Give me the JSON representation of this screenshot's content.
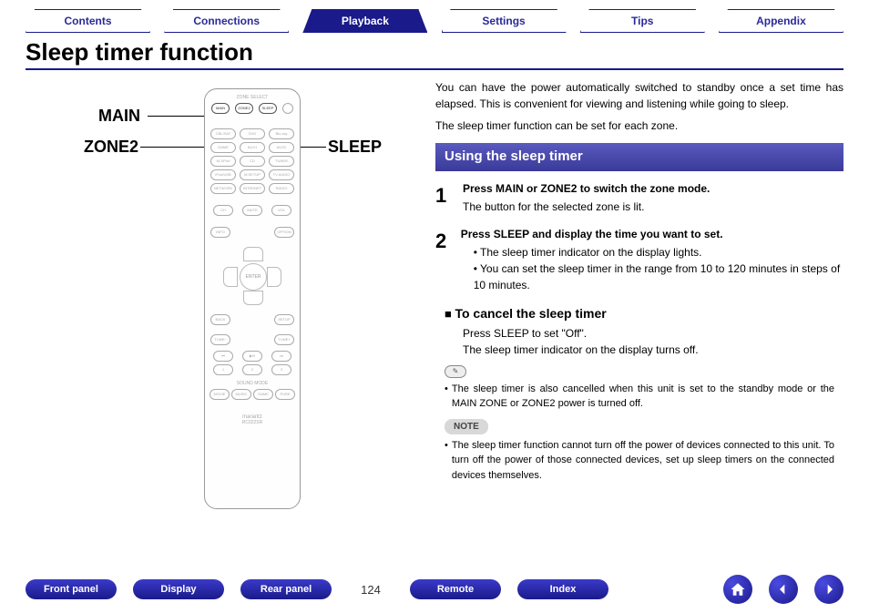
{
  "tabs": {
    "contents": "Contents",
    "connections": "Connections",
    "playback": "Playback",
    "settings": "Settings",
    "tips": "Tips",
    "appendix": "Appendix",
    "active": "playback"
  },
  "page_title": "Sleep timer function",
  "remote_labels": {
    "main": "MAIN",
    "zone2": "ZONE2",
    "sleep": "SLEEP",
    "zone_select": "ZONE SELECT",
    "enter": "ENTER",
    "power": "POWER",
    "brand": "marantz",
    "model": "RC022SR"
  },
  "intro": {
    "p1": "You can have the power automatically switched to standby once a set time has elapsed. This is convenient for viewing and listening while going to sleep.",
    "p2": "The sleep timer function can be set for each zone."
  },
  "section_header": "Using the sleep timer",
  "steps": [
    {
      "num": "1",
      "title": "Press MAIN or ZONE2 to switch the zone mode.",
      "text": "The button for the selected zone is lit."
    },
    {
      "num": "2",
      "title": "Press SLEEP and display the time you want to set.",
      "bullets": [
        "The sleep timer indicator on the display lights.",
        "You can set the sleep timer in the range from 10 to 120 minutes in steps of 10 minutes."
      ]
    }
  ],
  "cancel": {
    "heading": "To cancel the sleep timer",
    "line1": "Press SLEEP to set \"Off\".",
    "line2": "The sleep timer indicator on the display turns off."
  },
  "pencil_icon": "✎",
  "note1": "The sleep timer is also cancelled when this unit is set to the standby mode or the MAIN ZONE or ZONE2 power is turned off.",
  "note_label": "NOTE",
  "note2": "The sleep timer function cannot turn off the power of devices connected to this unit. To turn off the power of those connected devices, set up sleep timers on the connected devices themselves.",
  "footer": {
    "front_panel": "Front panel",
    "display": "Display",
    "rear_panel": "Rear panel",
    "page_num": "124",
    "remote": "Remote",
    "index": "Index"
  }
}
